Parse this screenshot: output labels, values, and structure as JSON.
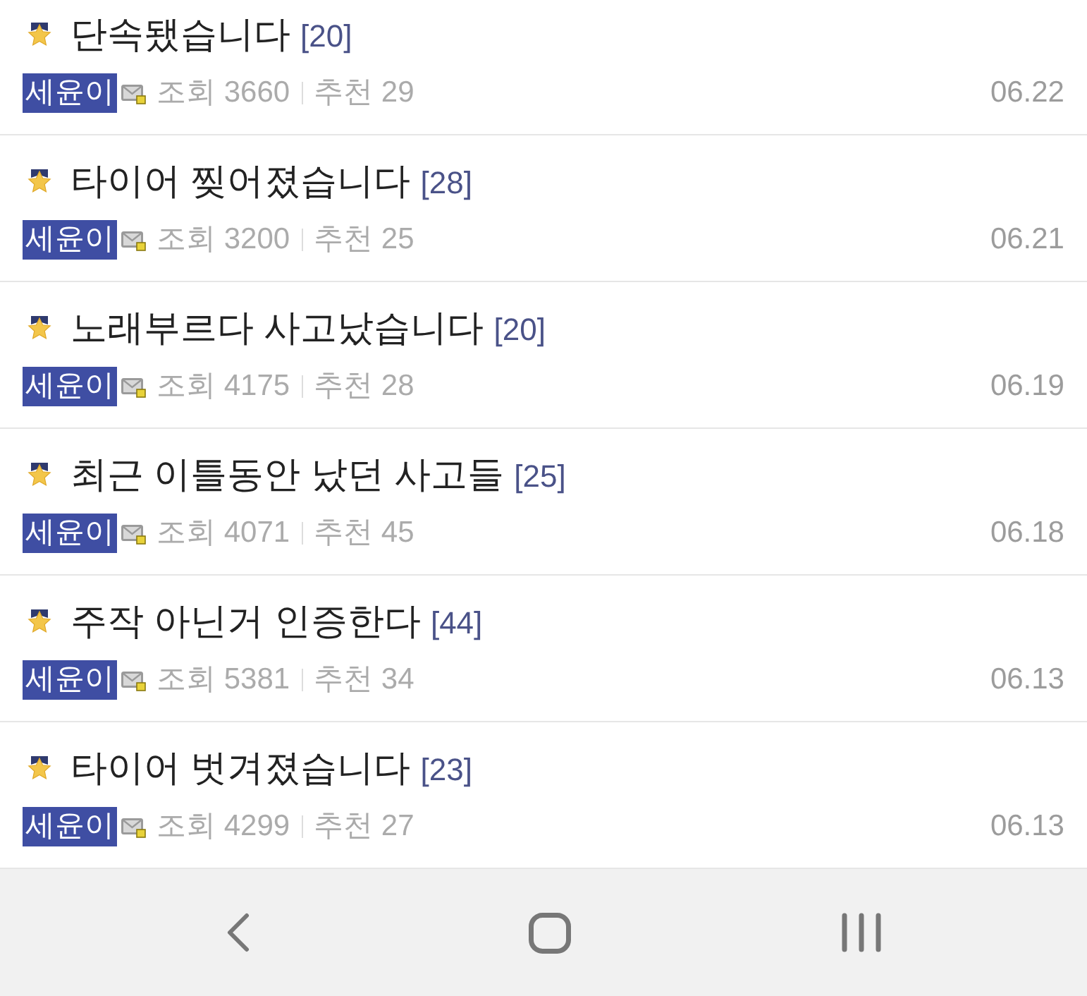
{
  "posts": [
    {
      "title": "단속됐습니다",
      "comments": "[20]",
      "author": "세윤이",
      "views": "조회 3660",
      "likes": "추천 29",
      "date": "06.22"
    },
    {
      "title": "타이어 찢어졌습니다",
      "comments": "[28]",
      "author": "세윤이",
      "views": "조회 3200",
      "likes": "추천 25",
      "date": "06.21"
    },
    {
      "title": "노래부르다 사고났습니다",
      "comments": "[20]",
      "author": "세윤이",
      "views": "조회 4175",
      "likes": "추천 28",
      "date": "06.19"
    },
    {
      "title": "최근 이틀동안 났던 사고들",
      "comments": "[25]",
      "author": "세윤이",
      "views": "조회 4071",
      "likes": "추천 45",
      "date": "06.18"
    },
    {
      "title": "주작 아닌거 인증한다",
      "comments": "[44]",
      "author": "세윤이",
      "views": "조회 5381",
      "likes": "추천 34",
      "date": "06.13"
    },
    {
      "title": "타이어 벗겨졌습니다",
      "comments": "[23]",
      "author": "세윤이",
      "views": "조회 4299",
      "likes": "추천 27",
      "date": "06.13"
    }
  ]
}
